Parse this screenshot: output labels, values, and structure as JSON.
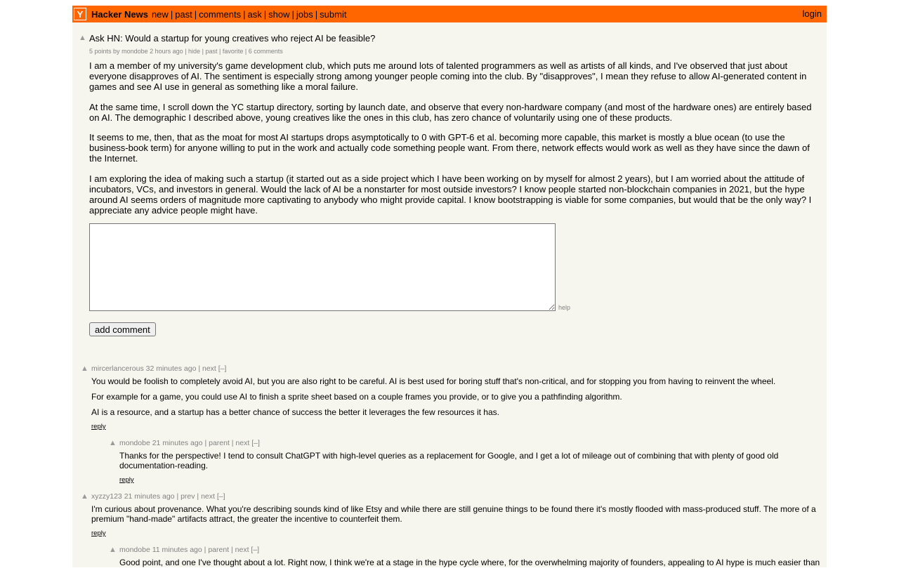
{
  "header": {
    "logo": "Y",
    "site_name": "Hacker News",
    "nav": [
      "new",
      "past",
      "comments",
      "ask",
      "show",
      "jobs",
      "submit"
    ],
    "login": "login"
  },
  "story": {
    "title": "Ask HN: Would a startup for young creatives who reject AI be feasible?",
    "points": "5 points",
    "by": "by",
    "author": "mondobe",
    "age": "2 hours ago",
    "links": [
      "hide",
      "past",
      "favorite",
      "6 comments"
    ],
    "text": [
      "I am a member of my university's game development club, which puts me around lots of talented programmers as well as artists of all kinds, and I've observed that just about everyone disapproves of AI. The sentiment is especially strong among younger people coming into the club. By \"disapproves\", I mean they refuse to allow AI-generated content in games and see AI use in general as something like a moral failure.",
      "At the same time, I scroll down the YC startup directory, sorting by launch date, and observe that every non-hardware company (and most of the hardware ones) are entirely based on AI. The demographic I described above, young creatives like the ones in this club, has zero chance of voluntarily using one of these products.",
      "It seems to me, then, that as the moat for most AI startups drops asymptotically to 0 with GPT-6 et al. becoming more capable, this market is mostly a blue ocean (to use the business-book term) for anyone willing to put in the work and actually code something people want. From there, network effects would work as well as they have since the dawn of the Internet.",
      "I am exploring the idea of making such a startup (it started out as a side project which I have been working on by myself for almost 2 years), but I am worried about the attitude of incubators, VCs, and investors in general. Would the lack of AI be a nonstarter for most outside investors? I know people started non-blockchain companies in 2021, but the hype around AI seems orders of magnitude more captivating to anybody who might provide capital. I know bootstrapping is viable for some companies, but would that be the only way? I appreciate any advice people might have."
    ]
  },
  "form": {
    "help": "help",
    "add_comment": "add comment"
  },
  "comments": [
    {
      "user": "mircerlancerous",
      "age": "32 minutes ago",
      "links": "| next [–]",
      "paragraphs": [
        "You would be foolish to completely avoid AI, but you are also right to be careful. AI is best used for boring stuff that's non-critical, and for stopping you from having to reinvent the wheel.",
        "For example for a game, you could use AI to finish a sprite sheet based on a couple frames you provide, or to give you a pathfinding algorithm.",
        "AI is a resource, and a startup has a better chance of success the better it leverages the few resources it has."
      ],
      "reply": "reply"
    },
    {
      "user": "mondobe",
      "age": "21 minutes ago",
      "links": "| parent | next [–]",
      "paragraphs": [
        "Thanks for the perspective! I tend to consult ChatGPT with high-level queries as a replacement for Google, and I get a lot of mileage out of combining that with plenty of good old documentation-reading."
      ],
      "reply": "reply"
    },
    {
      "user": "xyzzy123",
      "age": "21 minutes ago",
      "links": "| prev | next [–]",
      "paragraphs": [
        "I'm curious about provenance. What you're describing sounds kind of like Etsy and while there are still genuine things to be found there it's mostly flooded with mass-produced stuff. The more of a premium \"hand-made\" artifacts attract, the greater the incentive to counterfeit them."
      ],
      "reply": "reply"
    },
    {
      "user": "mondobe",
      "age": "11 minutes ago",
      "links": "| parent | next [–]",
      "paragraphs": [
        "Good point, and one I've thought about a lot. Right now, I think we're at a stage in the hype cycle where, for the overwhelming majority of founders, appealing to AI hype is much easier than"
      ]
    }
  ]
}
